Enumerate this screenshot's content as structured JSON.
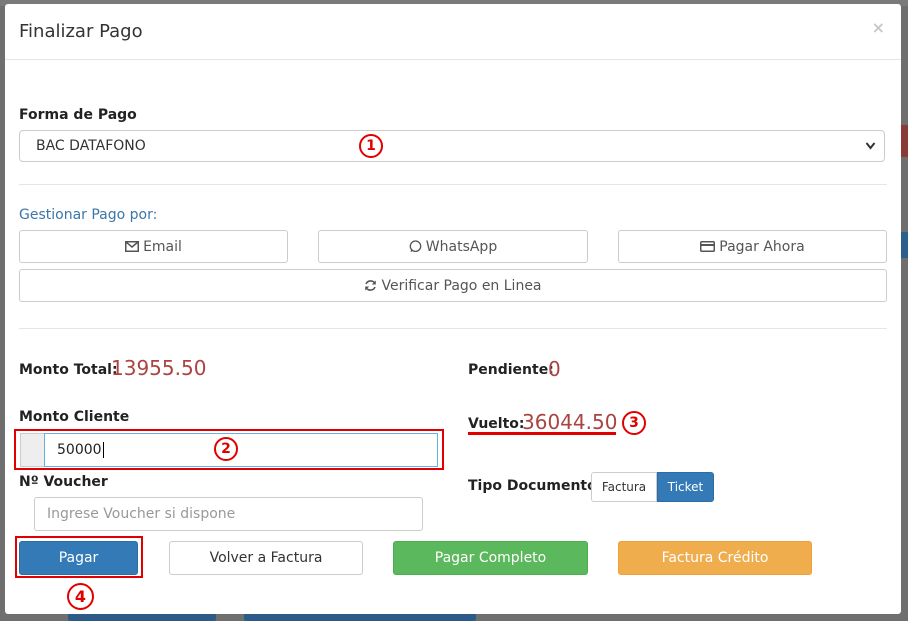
{
  "modal": {
    "title": "Finalizar Pago",
    "close_label": "×"
  },
  "forma_pago": {
    "label": "Forma de Pago",
    "selected": "BAC DATAFONO"
  },
  "gestionar": {
    "label": "Gestionar Pago por:",
    "email": "Email",
    "whatsapp": "WhatsApp",
    "pagar_ahora": "Pagar Ahora",
    "verificar": "Verificar Pago en Linea"
  },
  "totals": {
    "monto_total_label": "Monto Total:",
    "monto_total_value": "13955.50",
    "pendiente_label": "Pendiente:",
    "pendiente_value": "0",
    "vuelto_label": "Vuelto:",
    "vuelto_value": "36044.50"
  },
  "monto_cliente": {
    "label": "Monto Cliente",
    "value": "50000"
  },
  "voucher": {
    "label": "Nº Voucher",
    "placeholder": "Ingrese Voucher si dispone"
  },
  "tipo_documento": {
    "label": "Tipo Documento",
    "options": [
      "Factura",
      "Ticket"
    ],
    "selected": "Ticket"
  },
  "actions": {
    "pagar": "Pagar",
    "volver": "Volver a Factura",
    "completo": "Pagar Completo",
    "credito": "Factura Crédito"
  },
  "annotations": [
    "1",
    "2",
    "3",
    "4"
  ],
  "colors": {
    "accent_red": "#e00000",
    "amount_red": "#a94442",
    "primary": "#337ab7",
    "success": "#5cb85c",
    "warning": "#f0ad4e",
    "link": "#3a76a8"
  }
}
